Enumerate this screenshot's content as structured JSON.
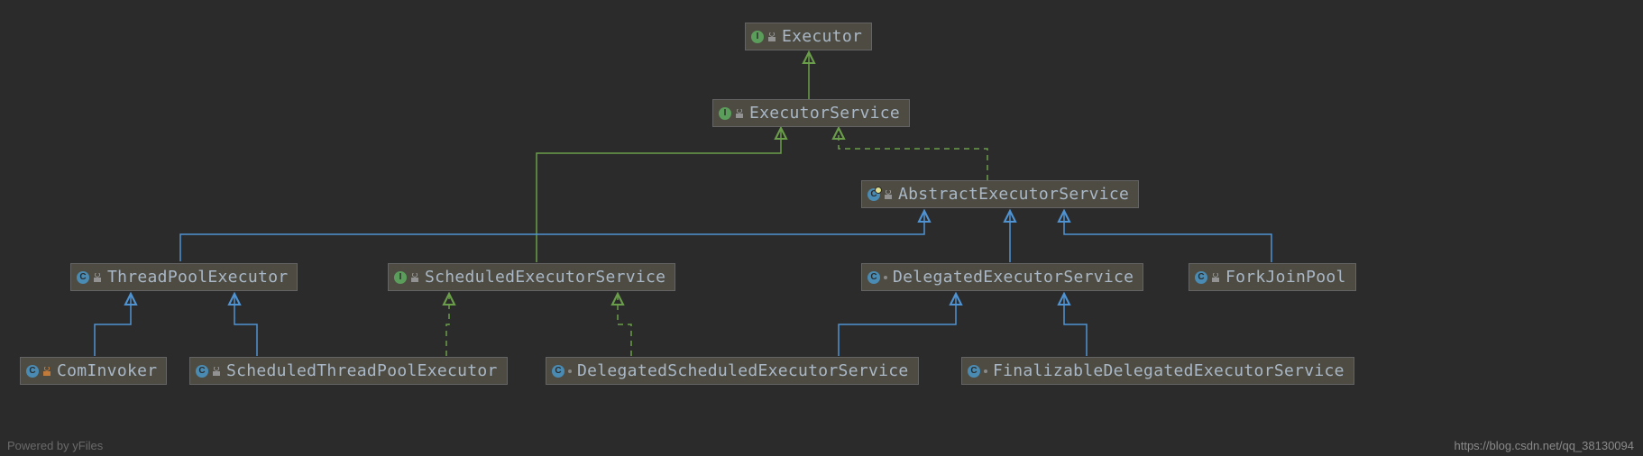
{
  "nodes": {
    "executor": {
      "label": "Executor",
      "kind": "interface",
      "vis": "lock-gray"
    },
    "executorService": {
      "label": "ExecutorService",
      "kind": "interface",
      "vis": "lock-gray"
    },
    "abstractExec": {
      "label": "AbstractExecutorService",
      "kind": "abstract",
      "vis": "lock-gray"
    },
    "threadPool": {
      "label": "ThreadPoolExecutor",
      "kind": "class",
      "vis": "lock-gray"
    },
    "schedExecSvc": {
      "label": "ScheduledExecutorService",
      "kind": "interface",
      "vis": "lock-gray"
    },
    "delegatedExec": {
      "label": "DelegatedExecutorService",
      "kind": "class",
      "vis": "dot"
    },
    "forkJoin": {
      "label": "ForkJoinPool",
      "kind": "class",
      "vis": "lock-gray"
    },
    "comInvoker": {
      "label": "ComInvoker",
      "kind": "class",
      "vis": "lock-orange"
    },
    "schedThreadPool": {
      "label": "ScheduledThreadPoolExecutor",
      "kind": "class",
      "vis": "lock-gray"
    },
    "delSchedExec": {
      "label": "DelegatedScheduledExecutorService",
      "kind": "class",
      "vis": "dot"
    },
    "finalDelExec": {
      "label": "FinalizableDelegatedExecutorService",
      "kind": "class",
      "vis": "dot"
    }
  },
  "iconLetters": {
    "interface": "I",
    "class": "C",
    "abstract": "C"
  },
  "edges": {
    "extends_color": "#4f93d2",
    "implements_color": "#6a9e4a"
  },
  "watermarks": {
    "left": "Powered by yFiles",
    "right": "https://blog.csdn.net/qq_38130094"
  }
}
